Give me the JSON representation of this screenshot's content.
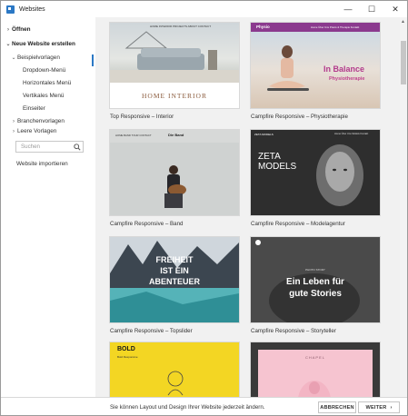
{
  "window": {
    "title": "Websites",
    "minimize_glyph": "—",
    "maximize_glyph": "☐",
    "close_glyph": "✕"
  },
  "sidebar": {
    "open": "Öffnen",
    "new_website": "Neue Website erstellen",
    "examples": "Beispielvorlagen",
    "dropdown_menu": "Dropdown-Menü",
    "horizontal_menu": "Horizontales Menü",
    "vertical_menu": "Vertikales Menü",
    "single_page": "Einseiter",
    "industry_templates": "Branchenvorlagen",
    "empty_templates": "Leere Vorlagen",
    "search_placeholder": "Suchen",
    "import": "Website importieren"
  },
  "templates": [
    {
      "caption": "Top Responsive – Interior",
      "thumb_text": "HOME INTERIOR",
      "nav": "HOME  INTERIOR  PROJECTS  ABOUT  CONTACT"
    },
    {
      "caption": "Campfire Responsive – Physiotherapie",
      "thumb_text": "In Balance",
      "thumb_sub": "Physiotherapie",
      "logo": "Physio",
      "nav": "Home  Über Uns  Praxis & Therapie  Kontakt"
    },
    {
      "caption": "Campfire Responsive – Band",
      "thumb_text": "Die Band",
      "nav": "HOME  BAND  TOUR  CONTACT"
    },
    {
      "caption": "Campfire Responsive – Modelagentur",
      "thumb_text": "ZETA MODELS",
      "logo": "ZETA MODELS",
      "nav": "Home  Über Uns  Models  Kontakt"
    },
    {
      "caption": "Campfire Responsive – Topslider",
      "thumb_lines": [
        "FREIHEIT",
        "IST EIN",
        "ABENTEUER"
      ]
    },
    {
      "caption": "Campfire Responsive – Storyteller",
      "thumb_lines": [
        "Ein Leben für",
        "gute Stories"
      ],
      "thumb_small": "PHOTO STORY"
    },
    {
      "caption": "",
      "thumb_text": "BOLD",
      "thumb_sub": "Bold Responsive"
    },
    {
      "caption": "",
      "thumb_text": "CHAPEL"
    }
  ],
  "footer": {
    "hint": "Sie können Layout und Design Ihrer Website jederzeit ändern.",
    "back": "ABBRECHEN",
    "next": "WEITER"
  },
  "colors": {
    "accent": "#2b78c5",
    "physio_overlay": "#b23a8c",
    "bold_yellow": "#f3d623",
    "story_pink": "#f6c4d0"
  }
}
